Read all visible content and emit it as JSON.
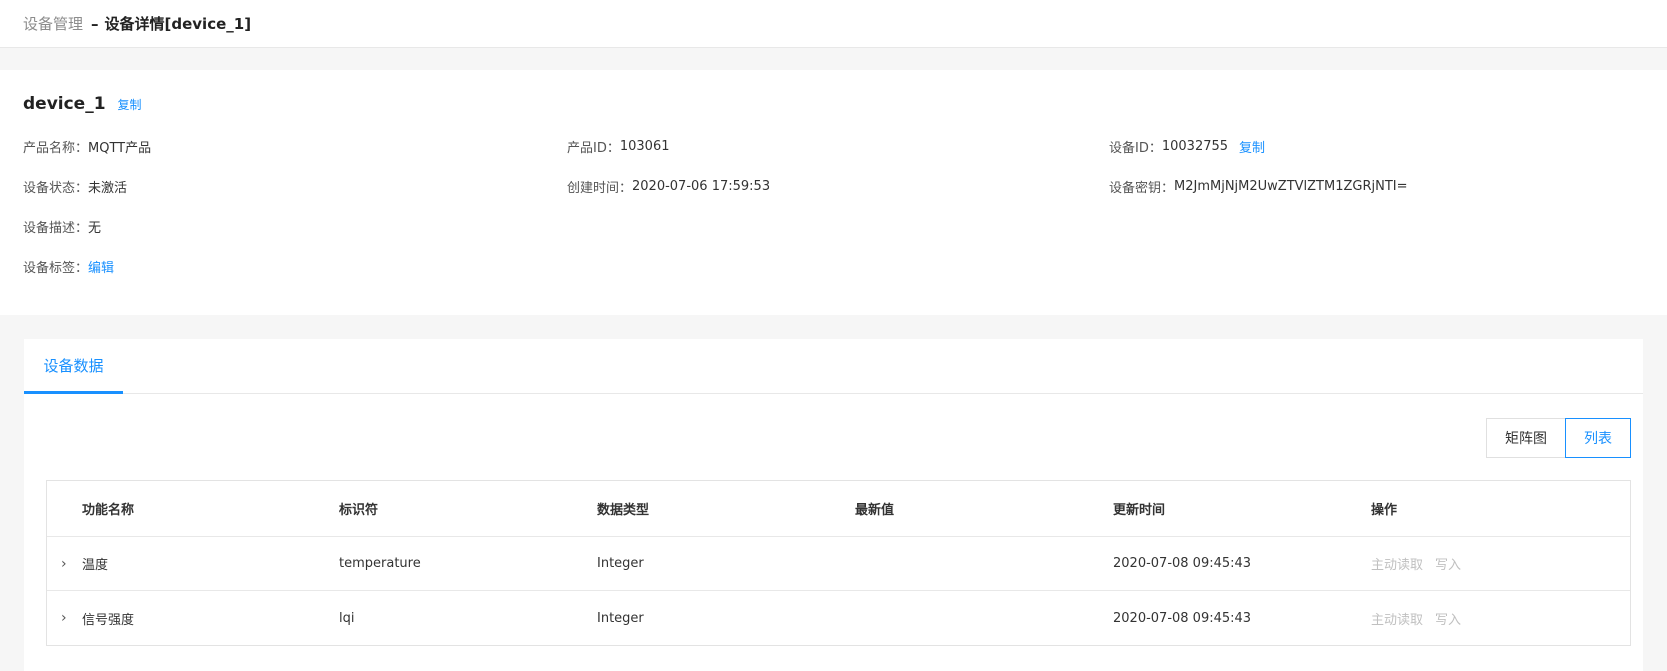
{
  "breadcrumb": {
    "root": "设备管理",
    "separator": "–",
    "current": "设备详情[device_1]"
  },
  "device": {
    "name": "device_1",
    "copy_label": "复制",
    "fields": {
      "product_name": {
        "label": "产品名称：",
        "value": "MQTT产品"
      },
      "product_id": {
        "label": "产品ID：",
        "value": "103061"
      },
      "device_id": {
        "label": "设备ID：",
        "value": "10032755",
        "action": "复制"
      },
      "status": {
        "label": "设备状态：",
        "value": "未激活"
      },
      "created": {
        "label": "创建时间：",
        "value": "2020-07-06 17:59:53"
      },
      "secret": {
        "label": "设备密钥：",
        "value": "M2JmMjNjM2UwZTVlZTM1ZGRjNTI="
      },
      "description": {
        "label": "设备描述：",
        "value": "无"
      },
      "tags": {
        "label": "设备标签：",
        "action": "编辑"
      }
    }
  },
  "tabs": [
    {
      "label": "设备数据",
      "active": true
    }
  ],
  "view_toggle": {
    "matrix": "矩阵图",
    "list": "列表",
    "active": "list"
  },
  "table": {
    "columns": [
      "功能名称",
      "标识符",
      "数据类型",
      "最新值",
      "更新时间",
      "操作"
    ],
    "rows": [
      {
        "name": "温度",
        "identifier": "temperature",
        "type": "Integer",
        "latest": "",
        "updated": "2020-07-08 09:45:43",
        "read": "主动读取",
        "write": "写入"
      },
      {
        "name": "信号强度",
        "identifier": "lqi",
        "type": "Integer",
        "latest": "",
        "updated": "2020-07-08 09:45:43",
        "read": "主动读取",
        "write": "写入"
      }
    ]
  },
  "icons": {
    "expand": "chevron-right-icon",
    "expand_glyph": "›"
  },
  "colors": {
    "accent": "#1890ff",
    "disabled_link": "#c0c0c0"
  }
}
